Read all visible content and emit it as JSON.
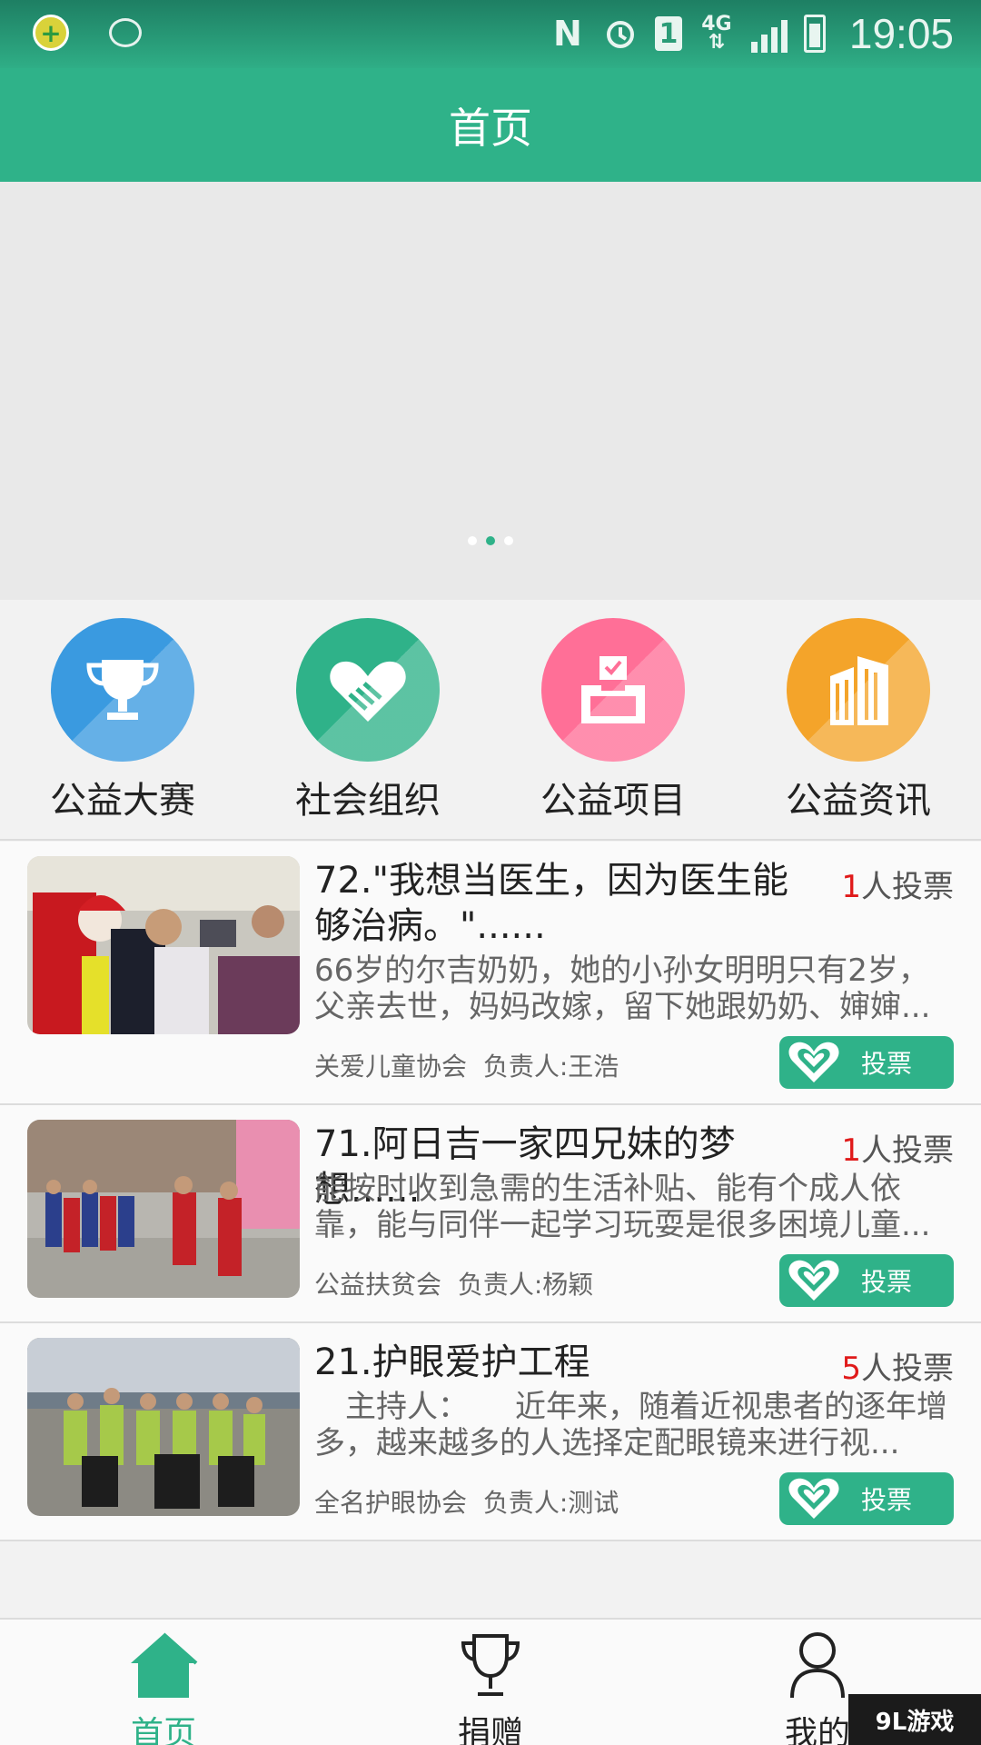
{
  "status_bar": {
    "time": "19:05",
    "network": "4G",
    "sim": "1",
    "nfc": "N"
  },
  "header": {
    "title": "首页"
  },
  "banner": {
    "dots": 3,
    "active_dot": 1
  },
  "categories": [
    {
      "label": "公益大赛",
      "icon": "trophy-icon",
      "color": "#3a9ae0"
    },
    {
      "label": "社会组织",
      "icon": "handshake-icon",
      "color": "#2fb289"
    },
    {
      "label": "公益项目",
      "icon": "ballot-box-icon",
      "color": "#ff6f97"
    },
    {
      "label": "公益资讯",
      "icon": "building-icon",
      "color": "#f4a42a"
    }
  ],
  "items": [
    {
      "title": "72.\"我想当医生，因为医生能够治病。\"......",
      "votes_num": "1",
      "votes_suffix": "人投票",
      "desc": "66岁的尔吉奶奶，她的小孙女明明只有2岁，父亲去世，妈妈改嫁，留下她跟奶奶、婶婶...",
      "org": "关爱儿童协会",
      "owner": "负责人:王浩",
      "vote_label": "投票"
    },
    {
      "title": "71.阿日吉一家四兄妹的梦想......",
      "votes_num": "1",
      "votes_suffix": "人投票",
      "desc": "能按时收到急需的生活补贴、能有个成人依靠，能与同伴一起学习玩耍是很多困境儿童...",
      "org": "公益扶贫会",
      "owner": "负责人:杨颖",
      "vote_label": "投票"
    },
    {
      "title": "21.护眼爱护工程",
      "votes_num": "5",
      "votes_suffix": "人投票",
      "desc": "　主持人：　　近年来，随着近视患者的逐年增多，越来越多的人选择定配眼镜来进行视...",
      "org": "全名护眼协会",
      "owner": "负责人:测试",
      "vote_label": "投票"
    }
  ],
  "bottom_nav": [
    {
      "label": "首页",
      "icon": "home-icon",
      "active": true
    },
    {
      "label": "捐赠",
      "icon": "trophy-icon",
      "active": false
    },
    {
      "label": "我的",
      "icon": "person-icon",
      "active": false
    }
  ],
  "watermark": "9L游戏",
  "colors": {
    "accent": "#2fb289",
    "vote_count": "#e01a1a"
  }
}
